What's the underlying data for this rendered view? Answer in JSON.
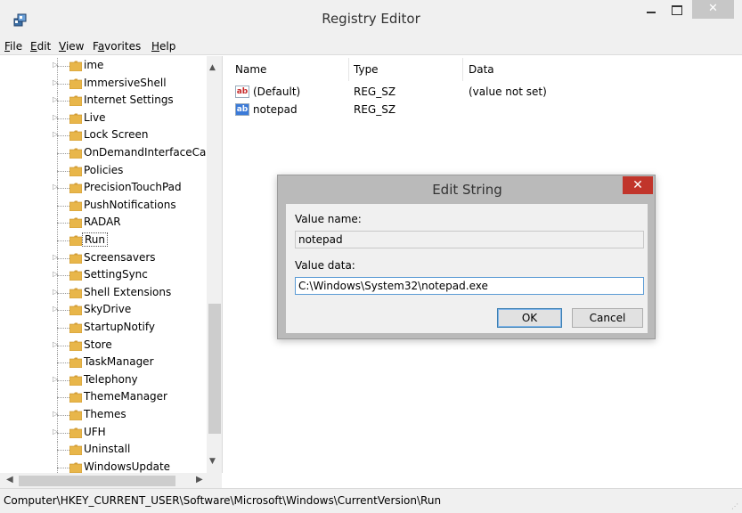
{
  "window": {
    "title": "Registry Editor",
    "close_glyph": "✕"
  },
  "menu": [
    {
      "label": "File"
    },
    {
      "label": "Edit"
    },
    {
      "label": "View"
    },
    {
      "label": "Favorites"
    },
    {
      "label": "Help"
    }
  ],
  "tree": {
    "items": [
      {
        "label": "ime",
        "expandable": true
      },
      {
        "label": "ImmersiveShell",
        "expandable": true
      },
      {
        "label": "Internet Settings",
        "expandable": true
      },
      {
        "label": "Live",
        "expandable": true
      },
      {
        "label": "Lock Screen",
        "expandable": true
      },
      {
        "label": "OnDemandInterfaceCac",
        "expandable": false
      },
      {
        "label": "Policies",
        "expandable": false
      },
      {
        "label": "PrecisionTouchPad",
        "expandable": true
      },
      {
        "label": "PushNotifications",
        "expandable": false
      },
      {
        "label": "RADAR",
        "expandable": false
      },
      {
        "label": "Run",
        "expandable": false,
        "selected": true
      },
      {
        "label": "Screensavers",
        "expandable": true
      },
      {
        "label": "SettingSync",
        "expandable": true
      },
      {
        "label": "Shell Extensions",
        "expandable": true
      },
      {
        "label": "SkyDrive",
        "expandable": true
      },
      {
        "label": "StartupNotify",
        "expandable": false
      },
      {
        "label": "Store",
        "expandable": true
      },
      {
        "label": "TaskManager",
        "expandable": false
      },
      {
        "label": "Telephony",
        "expandable": true
      },
      {
        "label": "ThemeManager",
        "expandable": false
      },
      {
        "label": "Themes",
        "expandable": true
      },
      {
        "label": "UFH",
        "expandable": true
      },
      {
        "label": "Uninstall",
        "expandable": false
      },
      {
        "label": "WindowsUpdate",
        "expandable": false
      }
    ]
  },
  "values": {
    "headers": {
      "name": "Name",
      "type": "Type",
      "data": "Data"
    },
    "rows": [
      {
        "icon": "ab",
        "name": "(Default)",
        "type": "REG_SZ",
        "data": "(value not set)"
      },
      {
        "icon": "ab",
        "name": "notepad",
        "type": "REG_SZ",
        "data": ""
      }
    ]
  },
  "status": {
    "path": "Computer\\HKEY_CURRENT_USER\\Software\\Microsoft\\Windows\\CurrentVersion\\Run"
  },
  "dialog": {
    "title": "Edit String",
    "close_glyph": "✕",
    "value_name_label": "Value name:",
    "value_name": "notepad",
    "value_data_label": "Value data:",
    "value_data": "C:\\Windows\\System32\\notepad.exe",
    "ok_label": "OK",
    "cancel_label": "Cancel"
  },
  "icons": {
    "app": "registry-editor-icon",
    "folder": "folder-icon",
    "string_value": "string-value-icon"
  },
  "colors": {
    "folder": "#e8b64a",
    "dialog_close": "#c1352b",
    "accent": "#3c7fb1"
  }
}
